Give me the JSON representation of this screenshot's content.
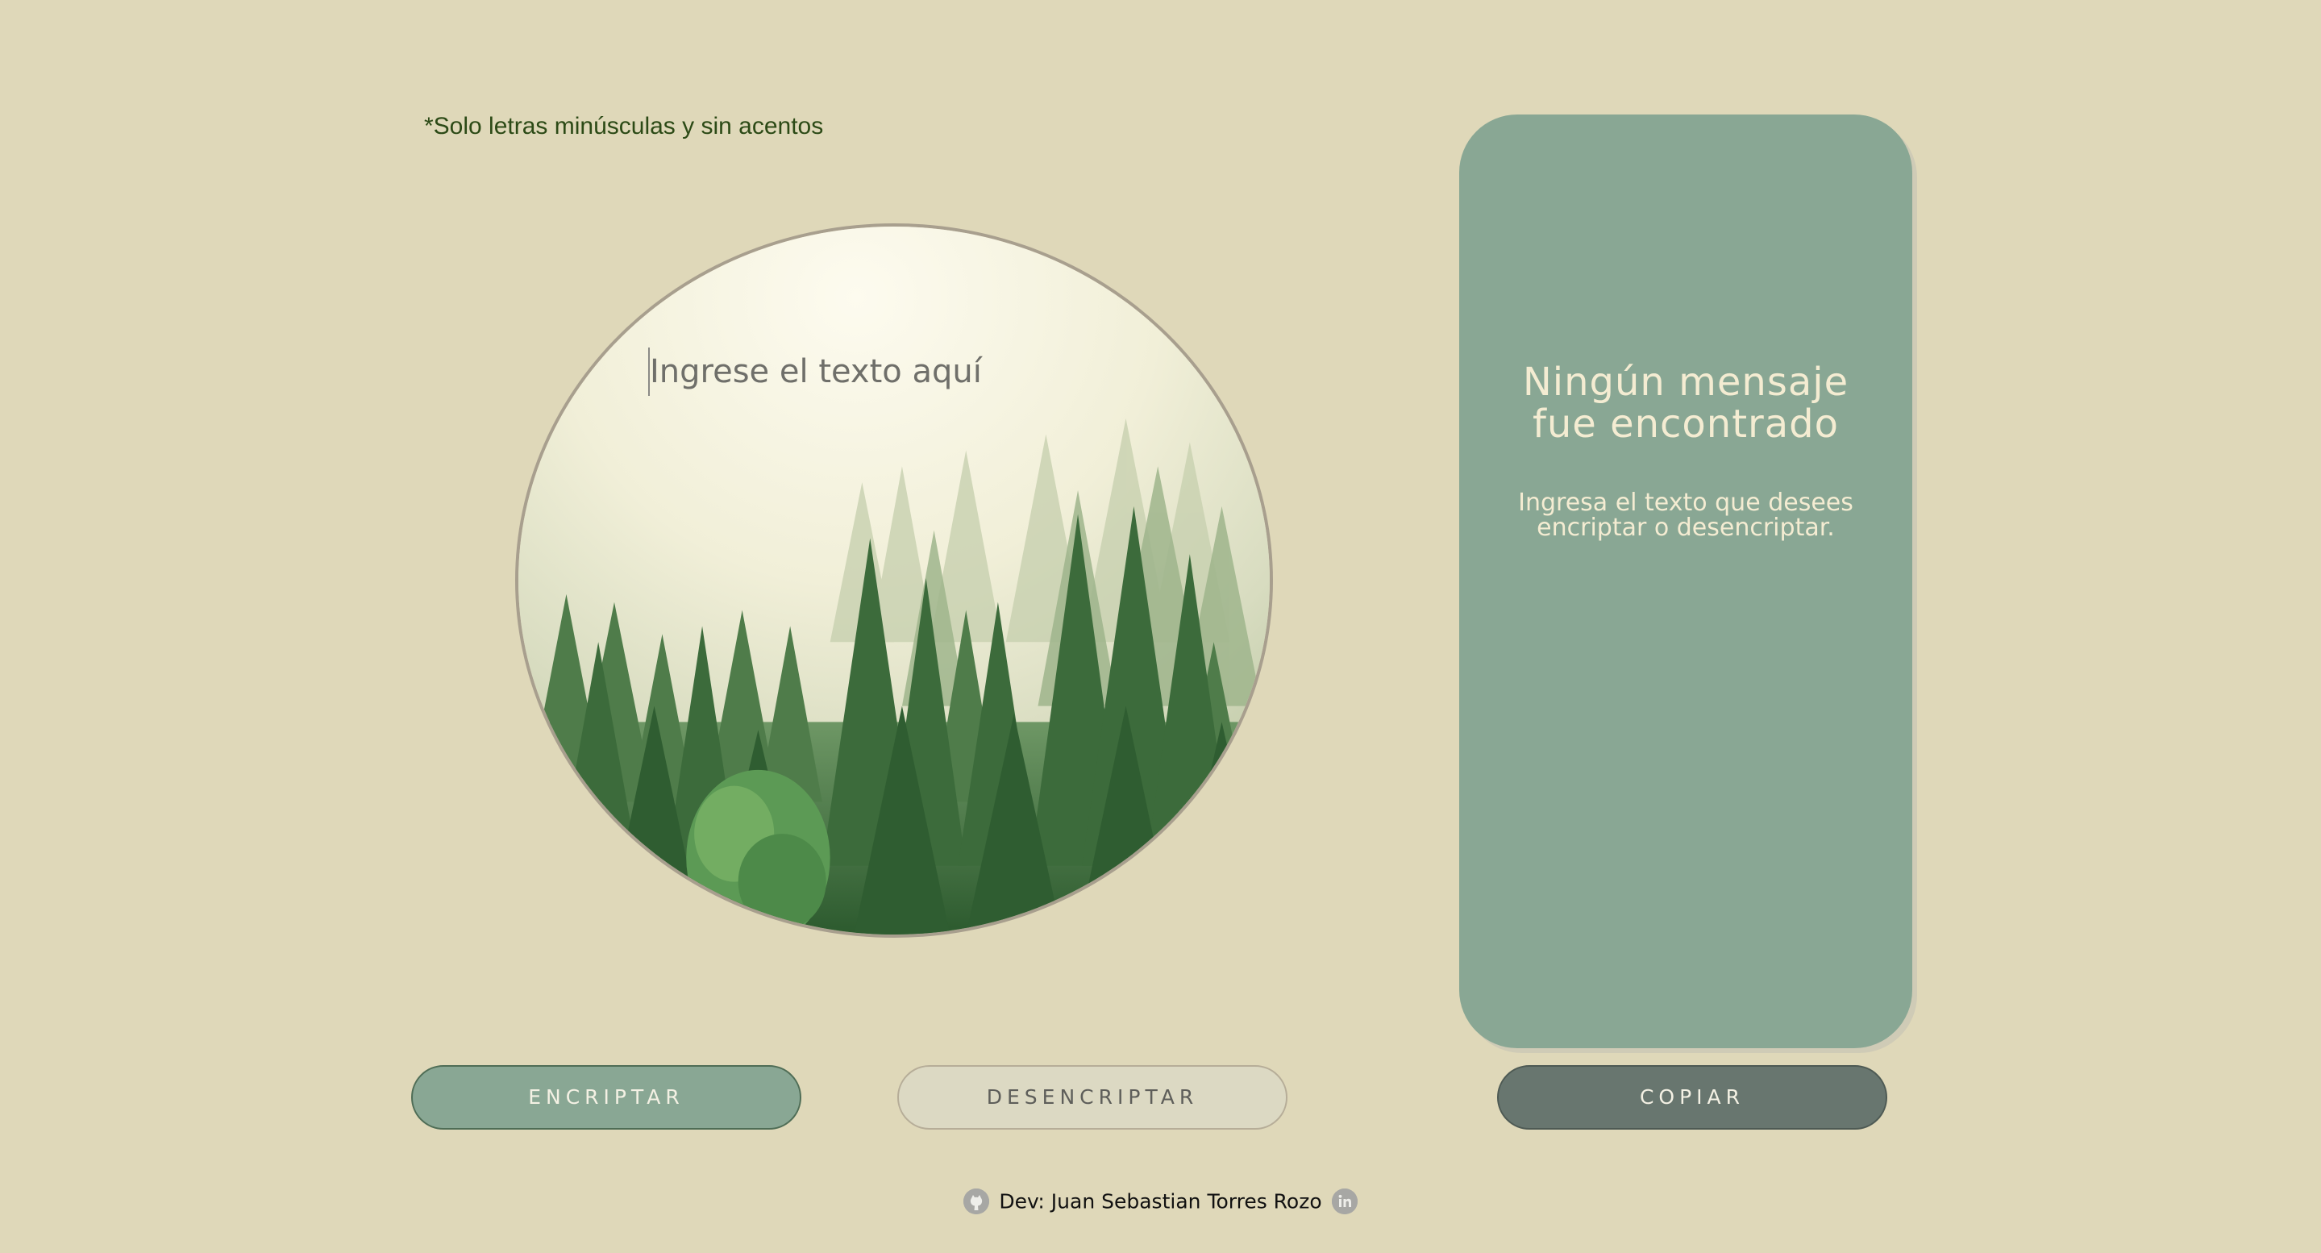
{
  "input_note": "*Solo letras minúsculas y sin acentos",
  "input": {
    "placeholder": "Ingrese el texto aquí",
    "value": ""
  },
  "panel": {
    "title_line1": "Ningún mensaje",
    "title_line2": "fue encontrado",
    "subtitle_line1": "Ingresa el texto que desees",
    "subtitle_line2": "encriptar o desencriptar."
  },
  "buttons": {
    "encrypt": "ENCRIPTAR",
    "decrypt": "DESENCRIPTAR",
    "copy": "COPIAR"
  },
  "footer": {
    "developer": "Dev: Juan Sebastian Torres Rozo",
    "github_icon": "github-icon",
    "linkedin_icon": "linkedin-icon"
  },
  "colors": {
    "background": "#dfd8b9",
    "panel": "#89a794",
    "encrypt_button": "#89a794",
    "decrypt_button": "#dcd9c3",
    "copy_button": "#68766f",
    "panel_text": "#f4ecd2",
    "note_text": "#2c4a16"
  }
}
